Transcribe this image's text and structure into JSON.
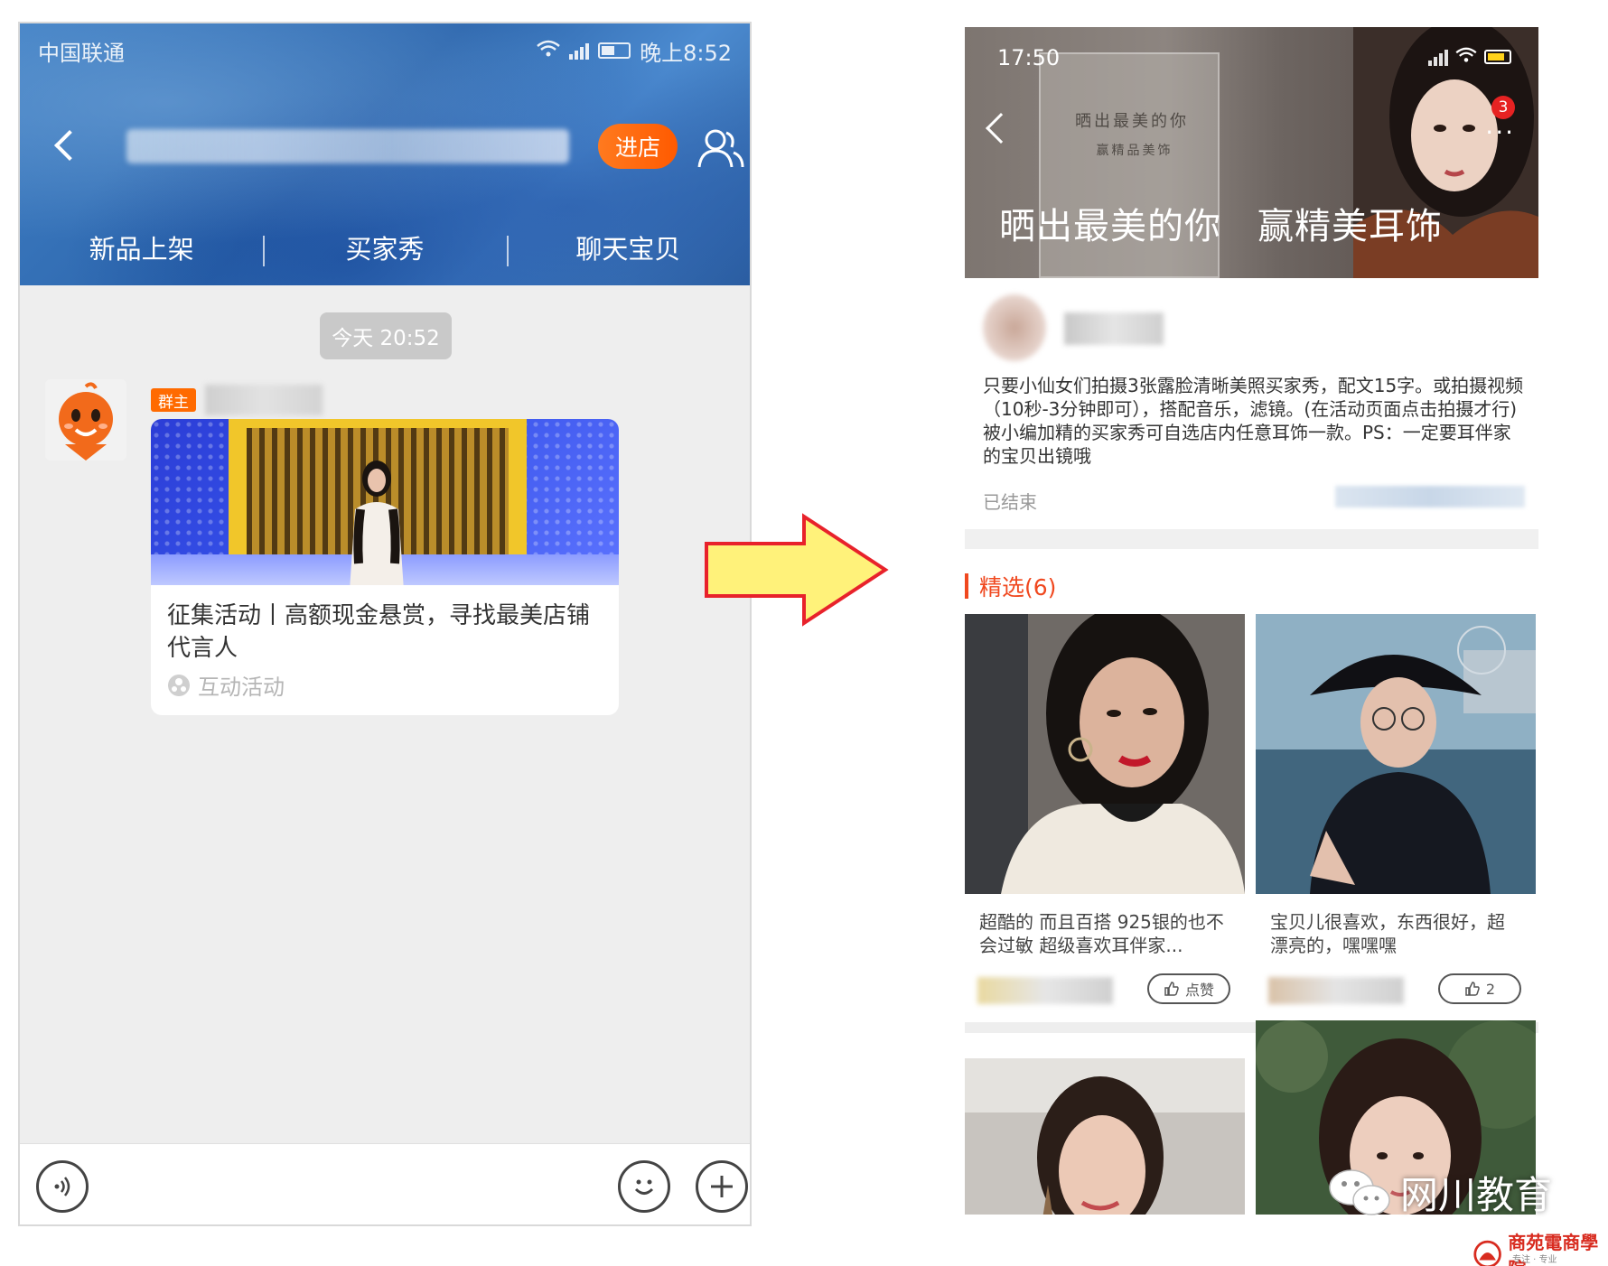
{
  "left_phone": {
    "status": {
      "carrier": "中国联通",
      "time": "晚上8:52"
    },
    "header": {
      "enter_store_label": "进店"
    },
    "tabs": [
      {
        "label": "新品上架"
      },
      {
        "label": "买家秀"
      },
      {
        "label": "聊天宝贝"
      }
    ],
    "chat": {
      "timestamp": "今天 20:52",
      "owner_badge": "群主",
      "card": {
        "title": "征集活动丨高额现金悬赏，寻找最美店铺代言人",
        "footer_label": "互动活动"
      }
    }
  },
  "right_phone": {
    "status": {
      "time": "17:50"
    },
    "notification_count": "3",
    "banner": {
      "poster_line1": "晒出最美的你",
      "poster_line2": "赢精品美饰",
      "headline_left": "晒出最美的你",
      "headline_right": "赢精美耳饰"
    },
    "activity": {
      "description": "只要小仙女们拍摄3张露脸清晰美照买家秀，配文15字。或拍摄视频（10秒-3分钟即可），搭配音乐，滤镜。(在活动页面点击拍摄才行)被小编加精的买家秀可自选店内任意耳饰一款。PS：一定要耳伴家的宝贝出镜哦",
      "status": "已结束"
    },
    "featured": {
      "title": "精选(6)",
      "items": [
        {
          "caption": "超酷的 而且百搭 925银的也不会过敏 超级喜欢耳伴家...",
          "like_label": "点赞"
        },
        {
          "caption": "宝贝儿很喜欢，东西很好，超漂亮的，嘿嘿嘿",
          "like_label": "2"
        }
      ]
    }
  },
  "watermark": {
    "text": "网川教育",
    "brand": "商苑電商學院",
    "brand_sub": "专注 · 专业"
  },
  "colors": {
    "accent_orange": "#ff6a00",
    "featured_red": "#f0481f",
    "arrow_fill": "#fff27a",
    "arrow_stroke": "#e8222b"
  }
}
